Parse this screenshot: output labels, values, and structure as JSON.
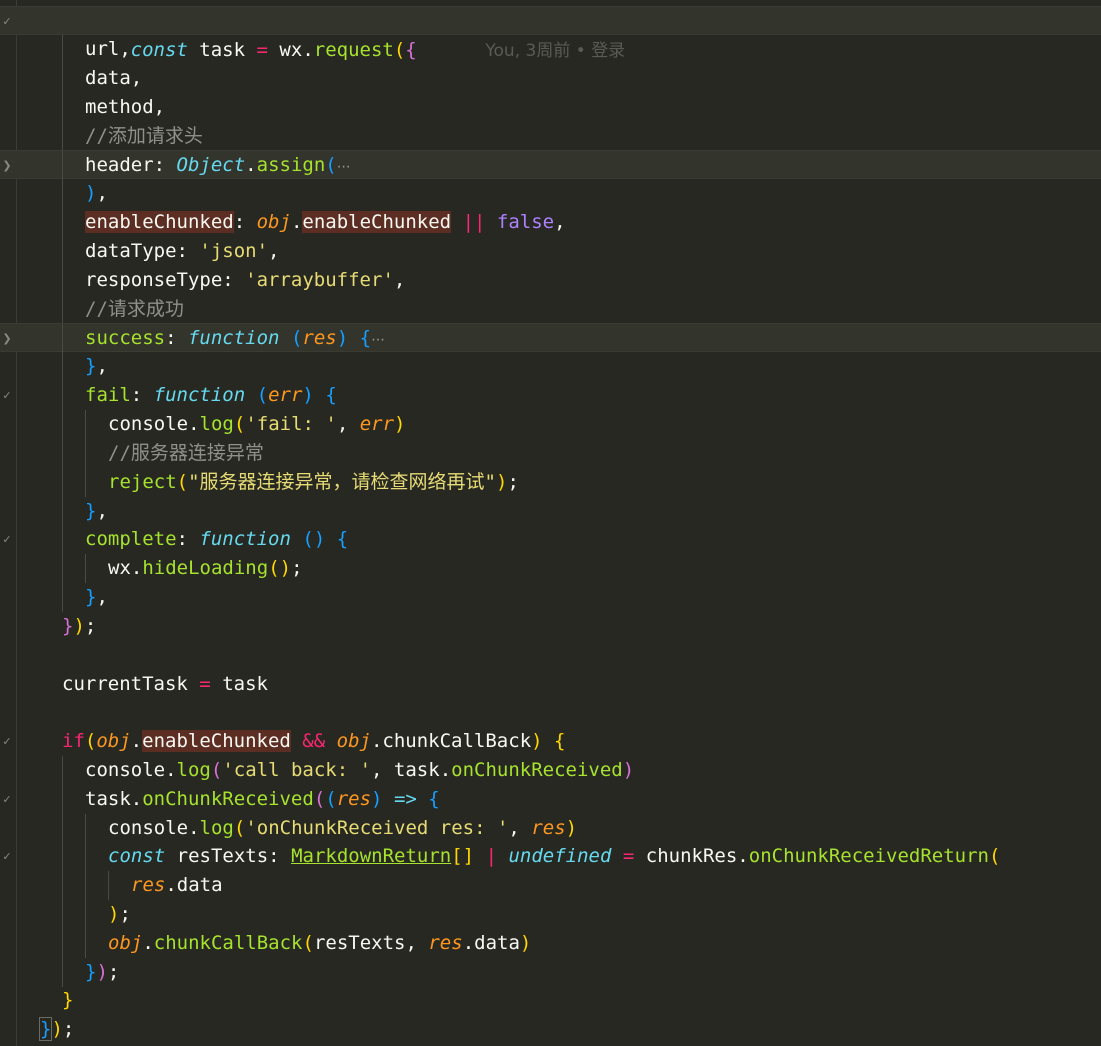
{
  "blame": {
    "author": "You",
    "when": "3周前",
    "message": "登录"
  },
  "code": {
    "l1_const": "const",
    "l1_task": "task",
    "l1_wx": "wx",
    "l1_request": "request",
    "l2": "url,",
    "l3": "data,",
    "l4": "method,",
    "comment_header": "//添加请求头",
    "header_key": "header",
    "object": "Object",
    "assign": "assign",
    "enableChunked": "enableChunked",
    "obj": "obj",
    "false": "false",
    "dataType_key": "dataType",
    "json": "'json'",
    "responseType_key": "responseType",
    "arraybuffer": "'arraybuffer'",
    "comment_success": "//请求成功",
    "success": "success",
    "function": "function",
    "res": "res",
    "fail": "fail",
    "err": "err",
    "console": "console",
    "log": "log",
    "fail_str": "'fail: '",
    "comment_server": "//服务器连接异常",
    "reject": "reject",
    "reject_str": "\"服务器连接异常，请检查网络再试\"",
    "complete": "complete",
    "wx": "wx",
    "hideLoading": "hideLoading",
    "currentTask": "currentTask",
    "task": "task",
    "if": "if",
    "chunkCallBack": "chunkCallBack",
    "callback_str": "'call back: '",
    "onChunkReceived": "onChunkReceived",
    "onChunk_str": "'onChunkReceived res: '",
    "const": "const",
    "resTexts": "resTexts",
    "MarkdownReturn": "MarkdownReturn",
    "undefined": "undefined",
    "chunkRes": "chunkRes",
    "onChunkReceivedReturn": "onChunkReceivedReturn",
    "data": "data"
  },
  "colors": {
    "background": "#272822",
    "keyword": "#66d9ef",
    "function": "#a6e22e",
    "string": "#e6db74",
    "comment": "#8f908a",
    "operator": "#f92672",
    "boolean": "#ae81ff",
    "parameter": "#fd971f",
    "highlight_match": "#5c2d22"
  },
  "icons": {
    "fold_open": "chevron-down-icon",
    "fold_closed": "chevron-right-icon"
  }
}
